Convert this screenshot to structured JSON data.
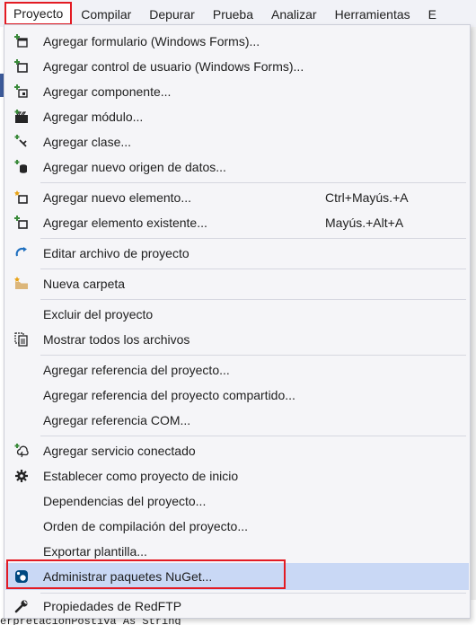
{
  "menubar": {
    "items": [
      {
        "label": "Proyecto",
        "active": true
      },
      {
        "label": "Compilar"
      },
      {
        "label": "Depurar"
      },
      {
        "label": "Prueba"
      },
      {
        "label": "Analizar"
      },
      {
        "label": "Herramientas"
      },
      {
        "label": "E"
      }
    ]
  },
  "menu": {
    "items": [
      {
        "label": "Agregar formulario (Windows Forms)...",
        "icon": "add-form-icon"
      },
      {
        "label": "Agregar control de usuario (Windows Forms)...",
        "icon": "add-user-control-icon"
      },
      {
        "label": "Agregar componente...",
        "icon": "add-component-icon"
      },
      {
        "label": "Agregar módulo...",
        "icon": "add-module-icon"
      },
      {
        "label": "Agregar clase...",
        "icon": "add-class-icon"
      },
      {
        "label": "Agregar nuevo origen de datos...",
        "icon": "add-datasource-icon"
      },
      {
        "label": "Agregar nuevo elemento...",
        "shortcut": "Ctrl+Mayús.+A",
        "icon": "add-new-item-icon"
      },
      {
        "label": "Agregar elemento existente...",
        "shortcut": "Mayús.+Alt+A",
        "icon": "add-existing-item-icon"
      },
      {
        "label": "Editar archivo de proyecto",
        "icon": "edit-project-icon"
      },
      {
        "label": "Nueva carpeta",
        "icon": "new-folder-icon"
      },
      {
        "label": "Excluir del proyecto"
      },
      {
        "label": "Mostrar todos los archivos",
        "icon": "show-all-files-icon"
      },
      {
        "label": "Agregar referencia del proyecto..."
      },
      {
        "label": "Agregar referencia del proyecto compartido..."
      },
      {
        "label": "Agregar referencia COM..."
      },
      {
        "label": "Agregar servicio conectado",
        "icon": "connected-service-icon"
      },
      {
        "label": "Establecer como proyecto de inicio",
        "icon": "gear-icon"
      },
      {
        "label": "Dependencias del proyecto..."
      },
      {
        "label": "Orden de compilación del proyecto..."
      },
      {
        "label": "Exportar plantilla..."
      },
      {
        "label": "Administrar paquetes NuGet...",
        "icon": "nuget-icon",
        "highlighted": true
      },
      {
        "label": "Propiedades de RedFTP",
        "icon": "wrench-icon"
      }
    ]
  },
  "background": {
    "bottom_code": "erpretacionPostiva As String"
  },
  "colors": {
    "menubar_bg": "#f1f2f7",
    "menu_bg": "#f5f5f8",
    "highlight_bg": "#c9d8f5",
    "annotation_red": "#e31b23",
    "icon_green": "#3a8a3a",
    "icon_dark": "#252526",
    "icon_blue": "#1f6fbf"
  }
}
